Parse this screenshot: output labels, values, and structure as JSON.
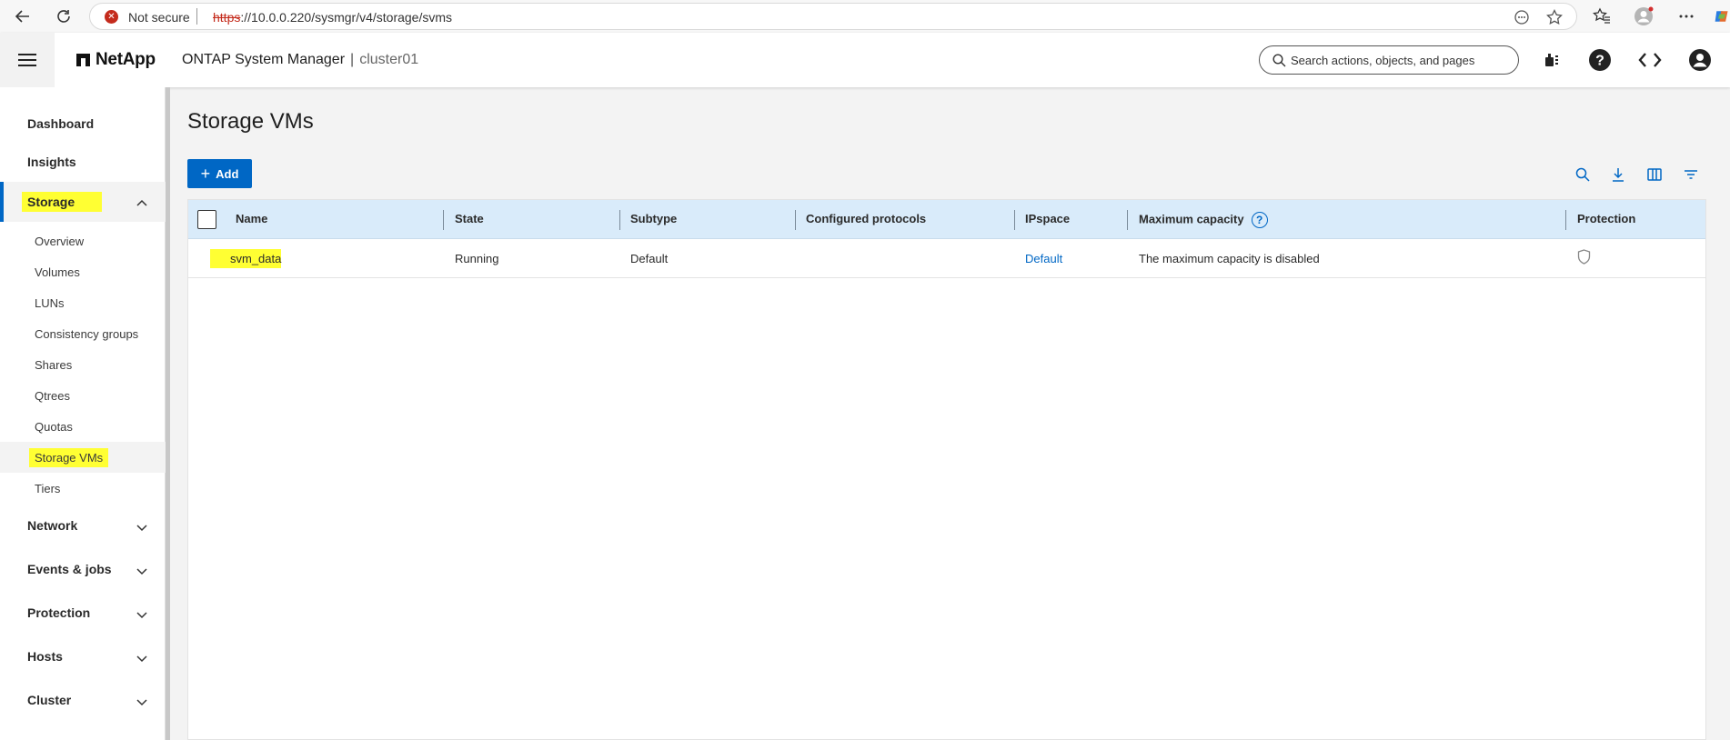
{
  "browser": {
    "security_label": "Not secure",
    "url_scheme": "https",
    "url_rest": "://10.0.0.220/sysmgr/v4/storage/svms"
  },
  "header": {
    "logo": "NetApp",
    "app_name": "ONTAP System Manager",
    "separator": "|",
    "cluster": "cluster01",
    "search_placeholder": "Search actions, objects, and pages"
  },
  "sidebar": {
    "dashboard": "Dashboard",
    "insights": "Insights",
    "storage": "Storage",
    "storage_items": [
      "Overview",
      "Volumes",
      "LUNs",
      "Consistency groups",
      "Shares",
      "Qtrees",
      "Quotas",
      "Storage VMs",
      "Tiers"
    ],
    "network": "Network",
    "events": "Events & jobs",
    "protection": "Protection",
    "hosts": "Hosts",
    "cluster": "Cluster"
  },
  "main": {
    "title": "Storage VMs",
    "add_label": "Add",
    "columns": [
      "Name",
      "State",
      "Subtype",
      "Configured protocols",
      "IPspace",
      "Maximum capacity",
      "Protection"
    ],
    "help_glyph": "?",
    "rows": [
      {
        "name": "svm_data",
        "state": "Running",
        "subtype": "Default",
        "protocols": "",
        "ipspace": "Default",
        "max_capacity": "The maximum capacity is disabled"
      }
    ]
  },
  "colors": {
    "accent": "#0067c5",
    "highlight": "#ffff33",
    "table_header": "#d9ebfa"
  }
}
